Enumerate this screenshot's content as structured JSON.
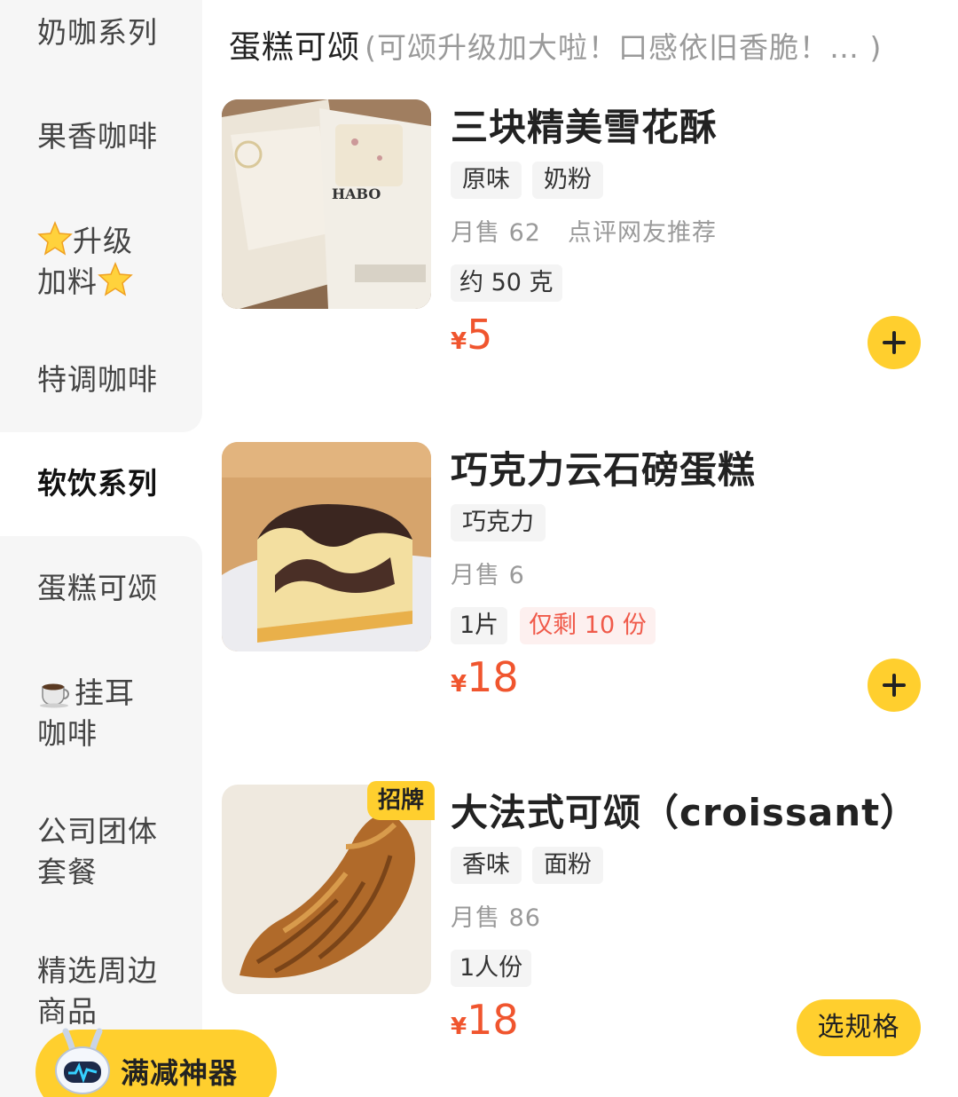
{
  "sidebar": {
    "items": [
      {
        "lines": [
          "奶咖系列"
        ]
      },
      {
        "lines": [
          "果香咖啡"
        ]
      },
      {
        "lines": [
          "升级",
          "加料"
        ]
      },
      {
        "lines": [
          "特调咖啡"
        ]
      },
      {
        "lines": [
          "软饮系列"
        ]
      },
      {
        "lines": [
          "蛋糕可颂"
        ]
      },
      {
        "lines": [
          "挂耳",
          "咖啡"
        ]
      },
      {
        "lines": [
          "公司团体",
          "套餐"
        ]
      },
      {
        "lines": [
          "精选周边",
          "商品"
        ]
      }
    ],
    "active_index": 4
  },
  "promo": {
    "label": "满减神器"
  },
  "section": {
    "title": "蛋糕可颂",
    "subtitle": "(可颂升级加大啦！口感依旧香脆！… )"
  },
  "products": [
    {
      "name": "三块精美雪花酥",
      "tags": [
        "原味",
        "奶粉"
      ],
      "monthly_sales": "月售 62",
      "recommend": "点评网友推荐",
      "specs": [
        "约 50 克"
      ],
      "currency": "¥",
      "price": "5",
      "action": "add"
    },
    {
      "name": "巧克力云石磅蛋糕",
      "tags": [
        "巧克力"
      ],
      "monthly_sales": "月售 6",
      "specs": [
        "1片"
      ],
      "stock_warning": "仅剩 10 份",
      "currency": "¥",
      "price": "18",
      "action": "add"
    },
    {
      "name": "大法式可颂（croissant）",
      "badge": "招牌",
      "tags": [
        "香味",
        "面粉"
      ],
      "monthly_sales": "月售 86",
      "specs": [
        "1人份"
      ],
      "currency": "¥",
      "price": "18",
      "action": "choose_spec",
      "action_label": "选规格"
    }
  ],
  "colors": {
    "accent": "#ffcf2e",
    "price": "#f0552e",
    "warning": "#f05a4a",
    "sidebar_bg": "#f6f6f6"
  },
  "icons": {
    "decor_star": "star-icon",
    "coffee_cup": "coffee-cup-icon",
    "mascot": "robot-mascot-icon",
    "add": "plus-icon"
  }
}
